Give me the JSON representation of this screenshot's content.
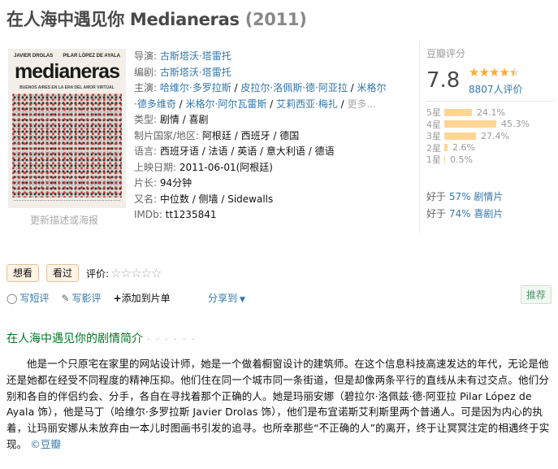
{
  "title": "在人海中遇见你 Medianeras",
  "year": "(2011)",
  "poster": {
    "actor_left": "JAVIER DROLAS",
    "actor_right": "PILAR LÓPEZ DE AYALA",
    "title": "medianeras",
    "tagline": "BUENOS AIRES EN LA ERA DEL AMOR VIRTUAL",
    "link": "更新描述或海报"
  },
  "info": {
    "director": {
      "label": "导演:",
      "names": [
        "古斯塔沃·塔雷托"
      ]
    },
    "writer": {
      "label": "编剧:",
      "names": [
        "古斯塔沃·塔雷托"
      ]
    },
    "cast": {
      "label": "主演:",
      "line1": [
        "哈维尔·多罗拉斯",
        "皮拉尔·洛佩斯·德·阿亚拉",
        "米格尔"
      ],
      "line2": [
        "·德多维奇",
        "米格尔·阿尔瓦雷斯",
        "艾莉西亚·梅扎"
      ],
      "more": "更多..."
    },
    "genre": {
      "label": "类型:",
      "value": "剧情 / 喜剧"
    },
    "region": {
      "label": "制片国家/地区:",
      "value": "阿根廷 / 西班牙 / 德国"
    },
    "language": {
      "label": "语言:",
      "value": "西班牙语 / 法语 / 英语 / 意大利语 / 德语"
    },
    "release": {
      "label": "上映日期:",
      "value": "2011-06-01(阿根廷)"
    },
    "runtime": {
      "label": "片长:",
      "value": "94分钟"
    },
    "aka": {
      "label": "又名:",
      "value": "中位数 / 侧墙 / Sidewalls"
    },
    "imdb": {
      "label": "IMDb:",
      "value": "tt1235841"
    }
  },
  "rating": {
    "label": "豆瓣评分",
    "score": "7.8",
    "stars": 4.5,
    "count": "8807人评价",
    "bars": [
      {
        "label": "5星",
        "percent_text": "24.1%",
        "percent": 24.1
      },
      {
        "label": "4星",
        "percent_text": "45.3%",
        "percent": 45.3
      },
      {
        "label": "3星",
        "percent_text": "27.4%",
        "percent": 27.4
      },
      {
        "label": "2星",
        "percent_text": "2.6%",
        "percent": 2.6
      },
      {
        "label": "1星",
        "percent_text": "0.5%",
        "percent": 0.5
      }
    ],
    "better_than": [
      {
        "prefix": "好于",
        "value": "57% 剧情片"
      },
      {
        "prefix": "好于",
        "value": "74% 喜剧片"
      }
    ]
  },
  "actions": {
    "want": "想看",
    "seen": "看过",
    "evaluate": "评价:"
  },
  "tools": {
    "short_review": "写短评",
    "review": "写影评",
    "add_list": "添加到片单",
    "share": "分享到",
    "recommend": "推荐"
  },
  "summary": {
    "title": "在人海中遇见你的剧情简介",
    "dots": "· · · · · ·",
    "text": "他是一个只原宅在家里的网站设计师，她是一个做着橱窗设计的建筑师。在这个信息科技高速发达的年代，无论是他还是她都在经受不同程度的精神压抑。他们住在同一个城市同一条街道，但是却像两条平行的直线从未有过交点。他们分别和各自的伴侣约会、分手，各自在寻找着那个正确的人。她是玛丽安娜（碧拉尔·洛佩兹·德·阿亚拉 Pilar López de Ayala 饰），他是马丁（哈维尔·多罗拉斯 Javier Drolas 饰），他们是布宜诺斯艾利斯里两个普通人。可是因为内心的执着，让玛丽安娜从未放弃由一本儿时图画书引发的追寻。也所幸那些“不正确的人”的离开，终于让冥冥注定的相遇终于实现。",
    "brand": "©豆瓣"
  },
  "colors": {
    "link": "#3377aa",
    "section_green": "#007722",
    "star": "#ffac2d",
    "bar": "#ffd596"
  }
}
